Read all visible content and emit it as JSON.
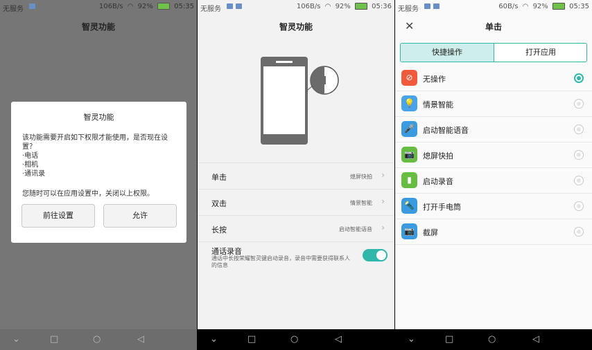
{
  "panel1": {
    "status": {
      "carrier": "无服务",
      "speed": "106B/s",
      "battery": "92%",
      "time": "05:35"
    },
    "title": "智灵功能",
    "dialog": {
      "title": "智灵功能",
      "message_lines": [
        "该功能需要开启如下权限才能使用，是否现在设置？",
        "·电话",
        "·相机",
        "·通讯录"
      ],
      "note": "您随时可以在应用设置中，关闭以上权限。",
      "left_button": "前往设置",
      "right_button": "允许"
    }
  },
  "panel2": {
    "status": {
      "carrier": "无服务",
      "speed": "106B/s",
      "battery": "92%",
      "time": "05:36"
    },
    "title": "智灵功能",
    "rows": [
      {
        "label": "单击",
        "value": "熄屏快拍"
      },
      {
        "label": "双击",
        "value": "情景智能"
      },
      {
        "label": "长按",
        "value": "启动智能语音"
      }
    ],
    "recording": {
      "label": "通话录音",
      "desc": "通话中长按荣耀智灵键启动录音，录音中需要获得联系人的信息",
      "enabled": true
    }
  },
  "panel3": {
    "status": {
      "carrier": "无服务",
      "speed": "60B/s",
      "battery": "92%",
      "time": "05:35"
    },
    "title": "单击",
    "tabs": [
      "快捷操作",
      "打开应用"
    ],
    "options": [
      {
        "label": "无操作",
        "icon": "no-entry-icon",
        "glyph": "⊘",
        "color": "#ef5b3b",
        "selected": true
      },
      {
        "label": "情景智能",
        "icon": "lightbulb-icon",
        "glyph": "💡",
        "color": "#4aa3e8",
        "selected": false
      },
      {
        "label": "启动智能语音",
        "icon": "microphone-icon",
        "glyph": "🎤",
        "color": "#3a9be0",
        "selected": false
      },
      {
        "label": "熄屏快拍",
        "icon": "camera-icon",
        "glyph": "📷",
        "color": "#67bd42",
        "selected": false
      },
      {
        "label": "启动录音",
        "icon": "audio-bars-icon",
        "glyph": "▮",
        "color": "#67bd42",
        "selected": false
      },
      {
        "label": "打开手电筒",
        "icon": "flashlight-icon",
        "glyph": "🔦",
        "color": "#3a9be0",
        "selected": false
      },
      {
        "label": "截屏",
        "icon": "screenshot-icon",
        "glyph": "📷",
        "color": "#3a9be0",
        "selected": false
      }
    ]
  }
}
